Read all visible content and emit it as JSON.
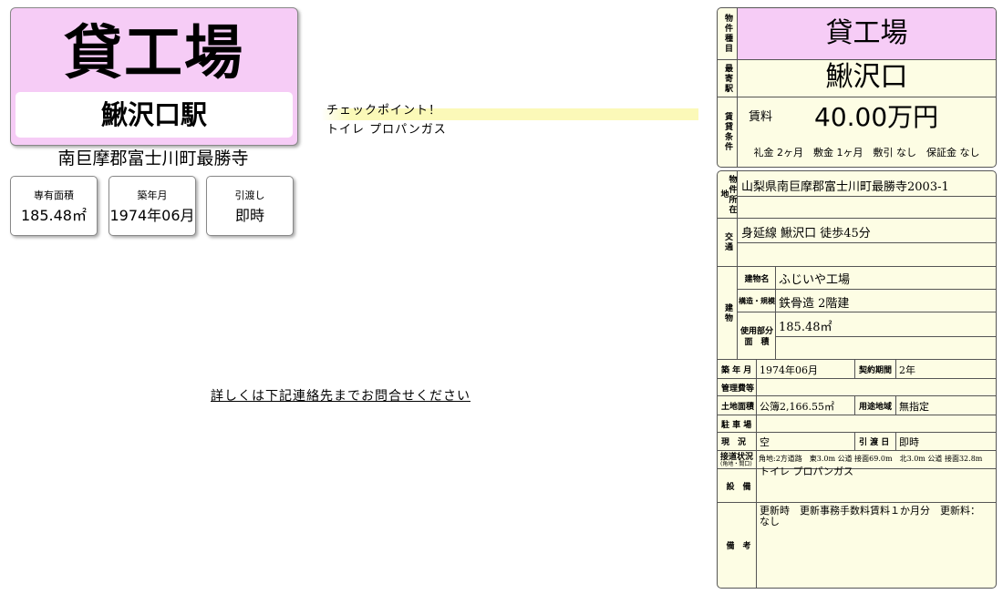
{
  "header": {
    "property_type": "貸工場",
    "station": "鰍沢口駅",
    "address": "南巨摩郡富士川町最勝寺"
  },
  "info_cards": [
    {
      "label": "専有面積",
      "value": "185.48㎡"
    },
    {
      "label": "築年月",
      "value": "1974年06月"
    },
    {
      "label": "引渡し",
      "value": "即時"
    }
  ],
  "checkpoint": {
    "title": "チェックポイント！",
    "body": "トイレ プロパンガス"
  },
  "contact_link": "詳しくは下記連絡先までお問合せください",
  "table": {
    "type_label": "物件種目",
    "type_value": "貸工場",
    "station_label": "最寄駅",
    "station_value": "鰍沢口",
    "rent_section_label": "賃貸条件",
    "rent_label": "賃料",
    "rent_value": "40.00万円",
    "rent_terms": "礼金 2ヶ月　敷金 1ヶ月　敷引 なし　保証金 なし",
    "location_label": "物件所在地",
    "location_value": "山梨県南巨摩郡富士川町最勝寺2003-1",
    "transport_label": "交通",
    "transport_value": "身延線 鰍沢口 徒歩45分",
    "building_label": "建物",
    "building_name_label": "建物名",
    "building_name_value": "ふじいや工場",
    "structure_label": "構造・規模",
    "structure_value": "鉄骨造 2階建",
    "usage_area_label_1": "使用部分",
    "usage_area_label_2": "面　積",
    "usage_area_value": "185.48㎡",
    "built_label": "築 年 月",
    "built_value": "1974年06月",
    "contract_label": "契約期間",
    "contract_value": "2年",
    "mgmt_label": "管理費等",
    "mgmt_value": "",
    "land_label": "土地面積",
    "land_value": "公簿2,166.55㎡",
    "zoning_label": "用途地域",
    "zoning_value": "無指定",
    "parking_label": "駐 車 場",
    "parking_value": "",
    "status_label": "現　況",
    "status_value": "空",
    "handover_label": "引 渡 日",
    "handover_value": "即時",
    "road_label": "接道状況",
    "road_sublabel": "(角地・間口)",
    "road_value": "角地:2方道路　東3.0m 公道 接面69.0m　北3.0m 公道 接面32.8m",
    "equipment_label": "設　備",
    "equipment_value": "トイレ プロパンガス",
    "remarks_label": "備　考",
    "remarks_value_1": "更新時　更新事務手数料賃料１か月分　更新料：",
    "remarks_value_2": "なし"
  }
}
